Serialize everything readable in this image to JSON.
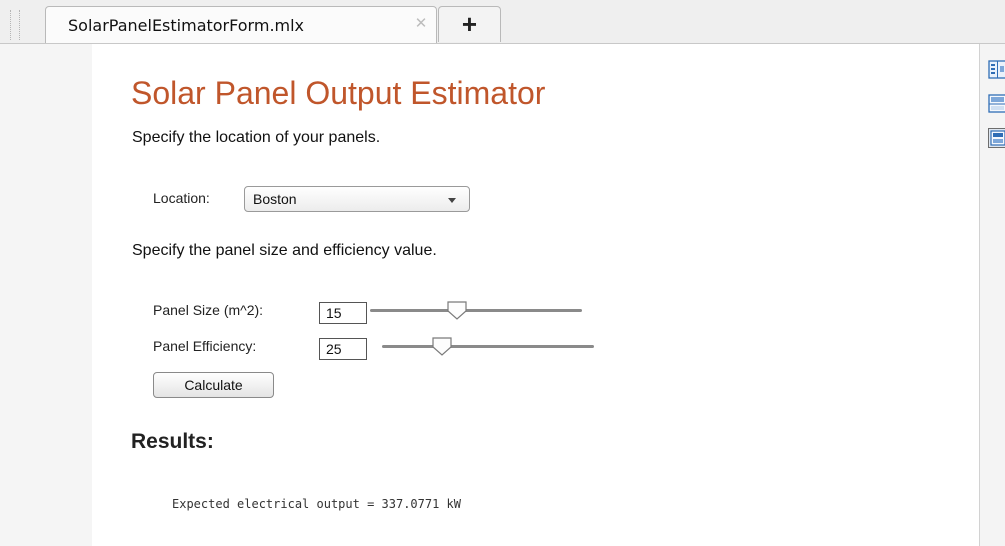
{
  "tab": {
    "title": "SolarPanelEstimatorForm.mlx",
    "close_icon": "close-icon",
    "new_tab_label": "+"
  },
  "document": {
    "title": "Solar Panel Output Estimator",
    "location_instruction": "Specify the location of your panels.",
    "location": {
      "label": "Location:",
      "selected": "Boston"
    },
    "size_instruction": "Specify the panel size and efficiency value.",
    "panel_size": {
      "label": "Panel Size (m^2):",
      "value": "15",
      "slider_fraction": 0.4
    },
    "panel_efficiency": {
      "label": "Panel Efficiency:",
      "value": "25",
      "slider_fraction": 0.26
    },
    "calculate_label": "Calculate",
    "results_heading": "Results:",
    "output_text": "Expected electrical output = 337.0771 kW"
  },
  "side_panel": {
    "icons": [
      "output-inline-icon",
      "output-right-icon",
      "hide-code-icon"
    ]
  },
  "colors": {
    "title_accent": "#c0562b",
    "icon_blue": "#2f6db5"
  }
}
